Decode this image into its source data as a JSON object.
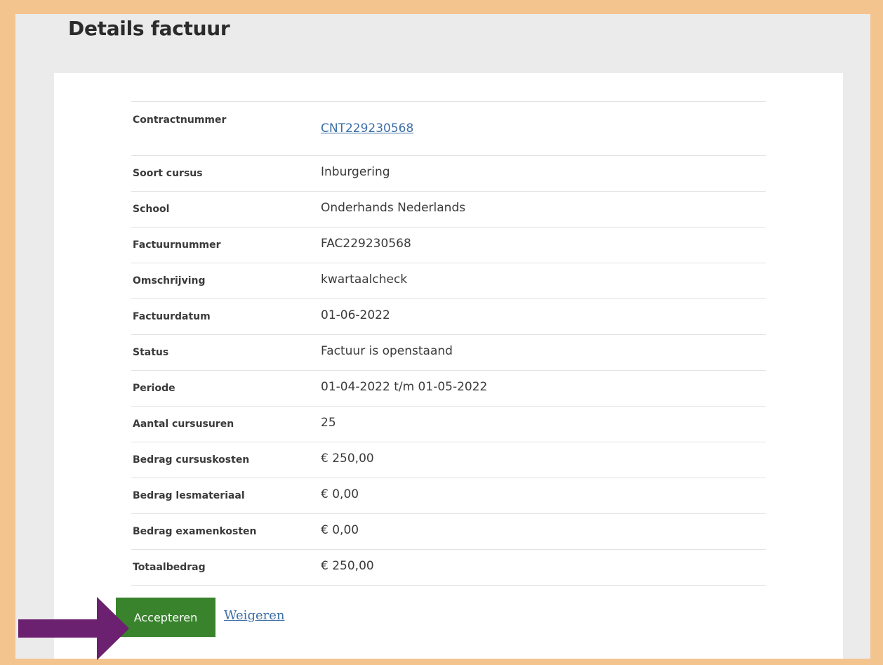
{
  "page": {
    "title": "Details factuur"
  },
  "details": [
    {
      "label": "Contractnummer",
      "value": "CNT229230568",
      "is_link": true
    },
    {
      "label": "Soort cursus",
      "value": "Inburgering"
    },
    {
      "label": "School",
      "value": "Onderhands Nederlands"
    },
    {
      "label": "Factuurnummer",
      "value": "FAC229230568"
    },
    {
      "label": "Omschrijving",
      "value": "kwartaalcheck"
    },
    {
      "label": "Factuurdatum",
      "value": "01-06-2022"
    },
    {
      "label": "Status",
      "value": "Factuur is openstaand"
    },
    {
      "label": "Periode",
      "value": "01-04-2022 t/m 01-05-2022"
    },
    {
      "label": "Aantal cursusuren",
      "value": "25"
    },
    {
      "label": "Bedrag cursuskosten",
      "value": "€ 250,00"
    },
    {
      "label": "Bedrag lesmateriaal",
      "value": "€ 0,00"
    },
    {
      "label": "Bedrag examenkosten",
      "value": "€ 0,00"
    },
    {
      "label": "Totaalbedrag",
      "value": "€ 250,00"
    }
  ],
  "actions": {
    "accept_label": "Accepteren",
    "refuse_label": "Weigeren"
  },
  "colors": {
    "outer_border": "#f4c48e",
    "page_background": "#ebebeb",
    "accept_button": "#38832c",
    "link": "#3d6fa6",
    "arrow": "#6b2170"
  },
  "annotations": {
    "arrow_icon": "right-arrow-icon"
  }
}
